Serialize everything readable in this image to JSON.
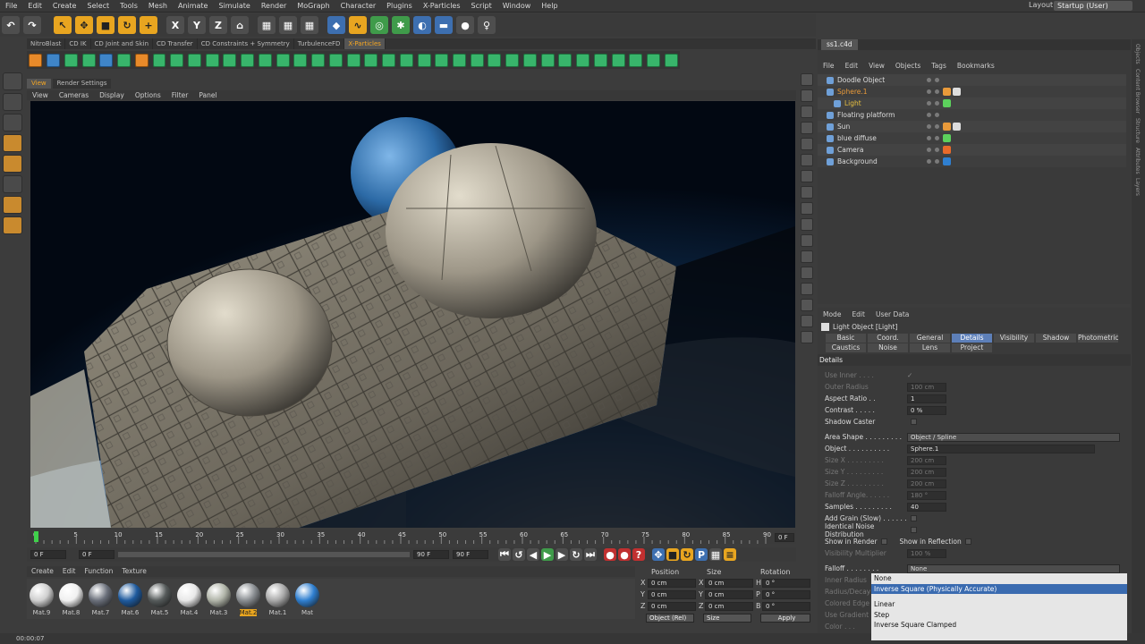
{
  "menubar": [
    "File",
    "Edit",
    "Create",
    "Select",
    "Tools",
    "Mesh",
    "Animate",
    "Simulate",
    "Render",
    "MoGraph",
    "Character",
    "Plugins",
    "X-Particles",
    "Script",
    "Window",
    "Help"
  ],
  "layout": {
    "label": "Layout:",
    "value": "Startup (User)"
  },
  "toolbar": {
    "x": "X",
    "y": "Y",
    "z": "Z"
  },
  "plugin_tabs": [
    "NitroBlast",
    "CD IK",
    "CD Joint and Skin",
    "CD Transfer",
    "CD Constraints + Symmetry",
    "TurbulenceFD",
    "X-Particles"
  ],
  "view_tabs": [
    "View",
    "Render Settings"
  ],
  "view_menu": [
    "View",
    "Cameras",
    "Display",
    "Options",
    "Filter",
    "Panel"
  ],
  "timeline": {
    "ticks": [
      "0",
      "5",
      "10",
      "15",
      "20",
      "25",
      "30",
      "35",
      "40",
      "45",
      "50",
      "55",
      "60",
      "65",
      "70",
      "75",
      "80",
      "85",
      "90"
    ],
    "end_frame": "0 F",
    "start_field": "0 F",
    "range_start": "0 F",
    "range_end": "90 F",
    "range_end2": "90 F"
  },
  "material_menu": [
    "Create",
    "Edit",
    "Function",
    "Texture"
  ],
  "materials": [
    {
      "name": "Mat.9",
      "color": "#cfcfcf"
    },
    {
      "name": "Mat.8",
      "color": "#f0f0f0"
    },
    {
      "name": "Mat.7",
      "color": "#6a6f7a"
    },
    {
      "name": "Mat.6",
      "color": "#1e5a9e"
    },
    {
      "name": "Mat.5",
      "color": "#555a5a"
    },
    {
      "name": "Mat.4",
      "color": "#e8e8e8"
    },
    {
      "name": "Mat.3",
      "color": "#b0b4a8"
    },
    {
      "name": "Mat.2",
      "color": "#888c90"
    },
    {
      "name": "Mat.1",
      "color": "#a8a8a8"
    },
    {
      "name": "Mat",
      "color": "#2f7fd0"
    }
  ],
  "coords": {
    "headers": [
      "Position",
      "Size",
      "Rotation"
    ],
    "rows": [
      {
        "a": "X",
        "p": "0 cm",
        "s": "X",
        "sv": "0 cm",
        "r": "H",
        "rv": "0 °"
      },
      {
        "a": "Y",
        "p": "0 cm",
        "s": "Y",
        "sv": "0 cm",
        "r": "P",
        "rv": "0 °"
      },
      {
        "a": "Z",
        "p": "0 cm",
        "s": "Z",
        "sv": "0 cm",
        "r": "B",
        "rv": "0 °"
      }
    ],
    "mode": "Object (Rel)",
    "size_mode": "Size",
    "apply": "Apply"
  },
  "status": "00:00:07",
  "file_tab": "ss1.c4d",
  "objects_menu": [
    "File",
    "Edit",
    "View",
    "Objects",
    "Tags",
    "Bookmarks"
  ],
  "objects": [
    {
      "name": "Doodle Object",
      "color": "#ddd",
      "indent": 0
    },
    {
      "name": "Sphere.1",
      "color": "#e89a3a",
      "indent": 0
    },
    {
      "name": "Light",
      "color": "#e8c040",
      "indent": 1
    },
    {
      "name": "Floating platform",
      "color": "#ddd",
      "indent": 0
    },
    {
      "name": "Sun",
      "color": "#ddd",
      "indent": 0
    },
    {
      "name": "blue diffuse",
      "color": "#ddd",
      "indent": 0
    },
    {
      "name": "Camera",
      "color": "#ddd",
      "indent": 0
    },
    {
      "name": "Background",
      "color": "#ddd",
      "indent": 0
    }
  ],
  "attr_menu": [
    "Mode",
    "Edit",
    "User Data"
  ],
  "attr_title": "Light Object [Light]",
  "attr_tabs_row1": [
    "Basic",
    "Coord.",
    "General",
    "Details",
    "Visibility",
    "Shadow",
    "Photometric"
  ],
  "attr_tabs_row2": [
    "Caustics",
    "Noise",
    "Lens",
    "Project"
  ],
  "attr_section": "Details",
  "attrs": [
    {
      "label": "Use Inner . . . .",
      "value": "✓",
      "dim": true,
      "type": "text"
    },
    {
      "label": "Outer Radius",
      "value": "100 cm",
      "dim": true,
      "type": "field"
    },
    {
      "label": "Aspect Ratio . .",
      "value": "1",
      "dim": false,
      "type": "field"
    },
    {
      "label": "Contrast . . . . .",
      "value": "0 %",
      "dim": false,
      "type": "field"
    },
    {
      "label": "Shadow Caster",
      "value": "",
      "dim": false,
      "type": "check"
    },
    {
      "label": "",
      "value": "",
      "dim": false,
      "type": "blank"
    },
    {
      "label": "Area Shape . . . . . . . . .",
      "value": "Object / Spline",
      "dim": false,
      "type": "wide"
    },
    {
      "label": "Object . . . . . . . . . .",
      "value": "Sphere.1",
      "dim": false,
      "type": "wide2"
    },
    {
      "label": "Size X . . . . . . . . .",
      "value": "200 cm",
      "dim": true,
      "type": "field"
    },
    {
      "label": "Size Y . . . . . . . . .",
      "value": "200 cm",
      "dim": true,
      "type": "field"
    },
    {
      "label": "Size Z . . . . . . . . .",
      "value": "200 cm",
      "dim": true,
      "type": "field"
    },
    {
      "label": "Falloff Angle. . . . . .",
      "value": "180 °",
      "dim": true,
      "type": "field"
    },
    {
      "label": "Samples . . . . . . . . .",
      "value": "40",
      "dim": false,
      "type": "field"
    },
    {
      "label": "Add Grain (Slow) . . . . . .",
      "value": "",
      "dim": false,
      "type": "check"
    },
    {
      "label": "Identical Noise Distribution",
      "value": "",
      "dim": false,
      "type": "check"
    },
    {
      "label": "Show in Render",
      "value": "Show in Reflection",
      "dim": false,
      "type": "twochk"
    },
    {
      "label": "Visibility Multiplier",
      "value": "100 %",
      "dim": true,
      "type": "field"
    },
    {
      "label": "",
      "value": "",
      "dim": false,
      "type": "blank"
    },
    {
      "label": "Falloff . . . . . . . .",
      "value": "None",
      "dim": false,
      "type": "wide"
    },
    {
      "label": "Inner Radius",
      "value": "",
      "dim": true,
      "type": "text"
    },
    {
      "label": "Radius/Decay",
      "value": "",
      "dim": true,
      "type": "text"
    },
    {
      "label": "Colored Edge",
      "value": "",
      "dim": true,
      "type": "text"
    },
    {
      "label": "Use Gradient",
      "value": "",
      "dim": true,
      "type": "text"
    },
    {
      "label": "Color . . .",
      "value": "",
      "dim": true,
      "type": "text"
    }
  ],
  "dropdown": [
    "None",
    "Inverse Square (Physically Accurate)",
    "Linear",
    "Step",
    "Inverse Square Clamped"
  ],
  "dropdown_highlight": 1,
  "side_rail": [
    "Objects",
    "Content Browser",
    "Structure",
    "Attributes",
    "Layers"
  ]
}
